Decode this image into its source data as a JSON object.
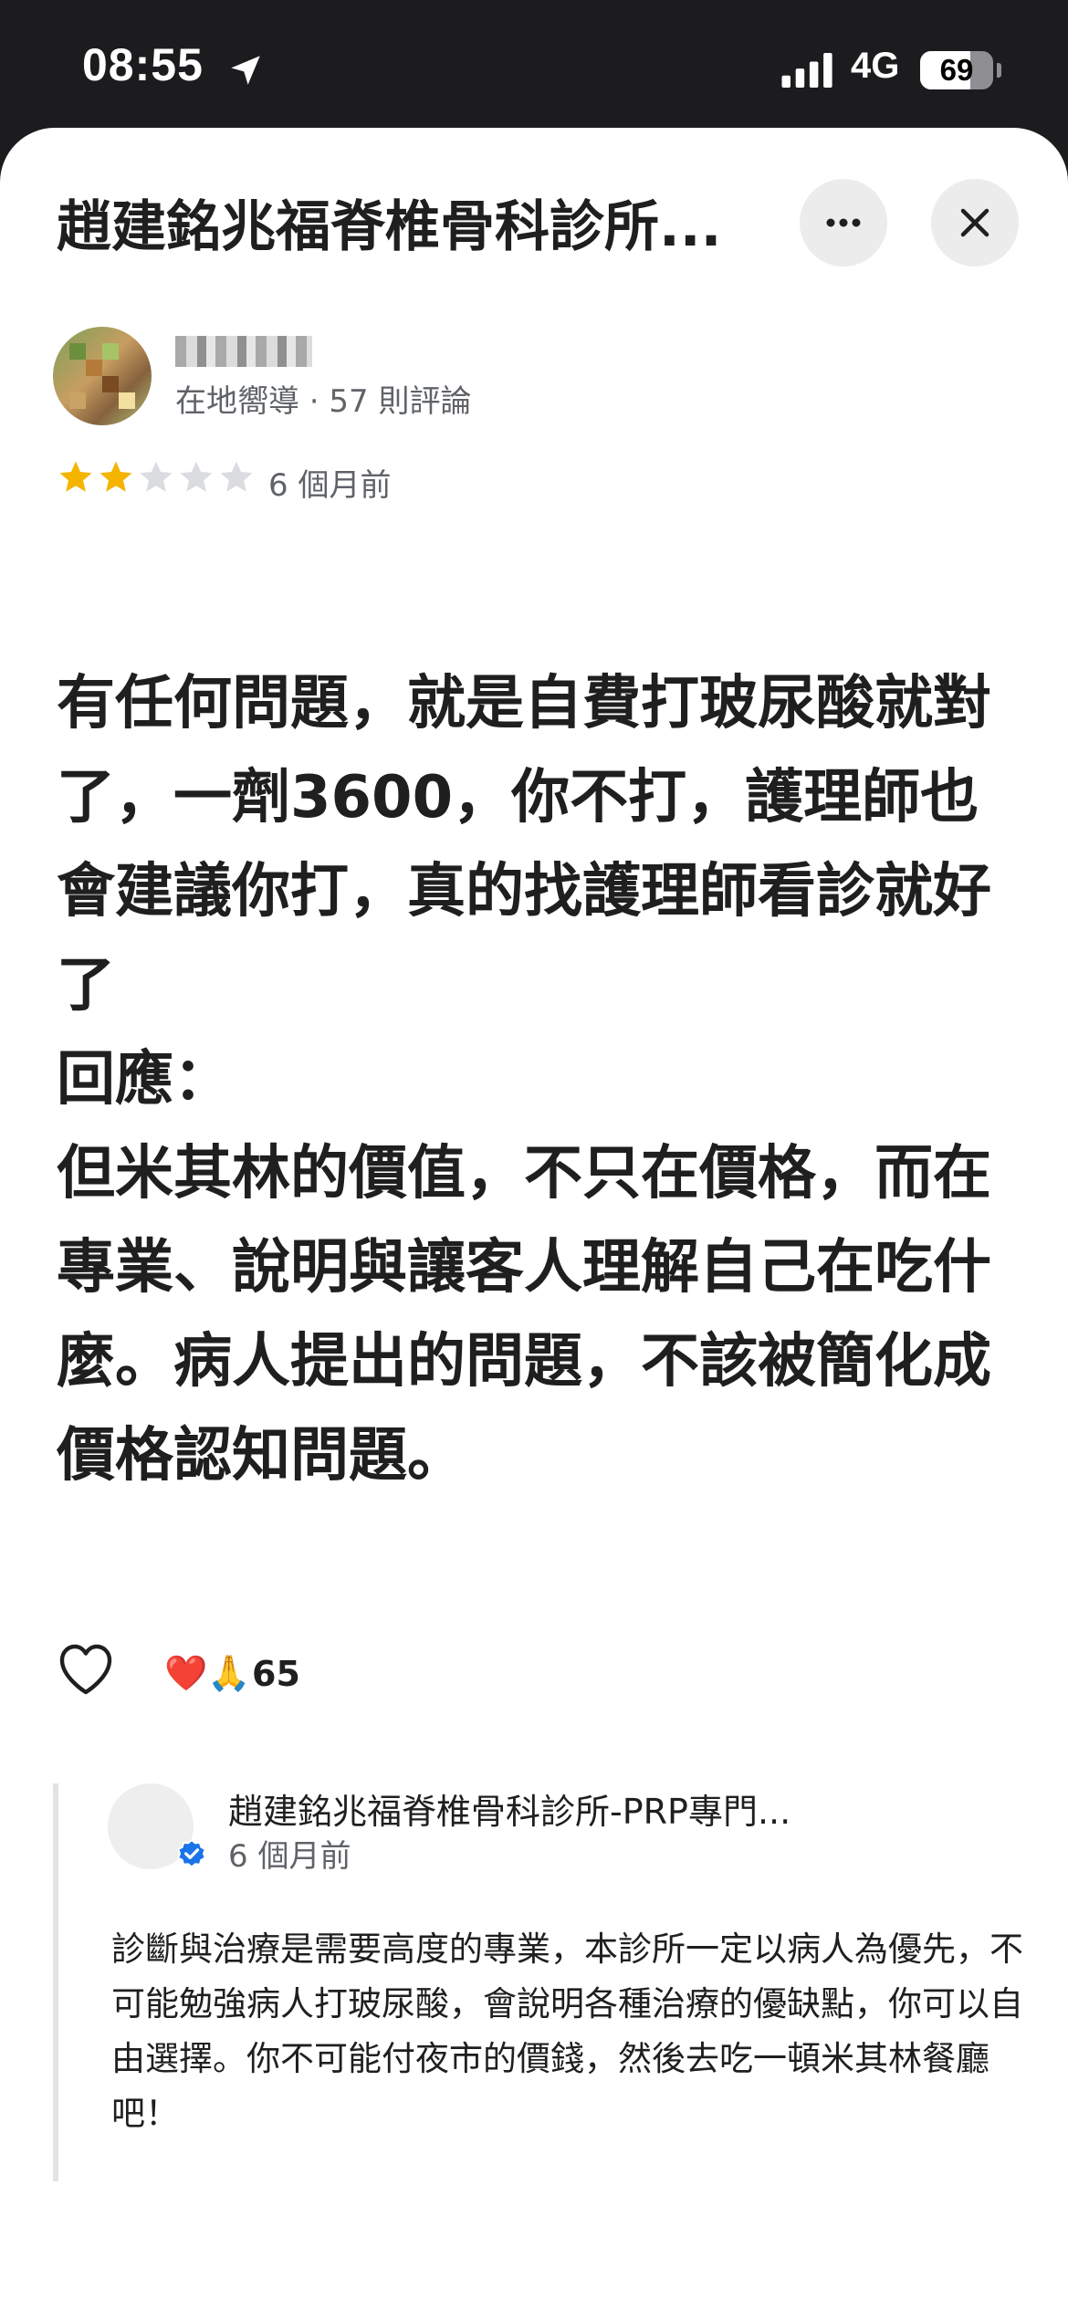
{
  "status_bar": {
    "time": "08:55",
    "network": "4G",
    "battery_percent": "69",
    "battery_level": 0.69,
    "location_icon": "location-arrow-icon",
    "signal_icon": "cellular-signal-icon"
  },
  "header": {
    "title": "趙建銘兆福脊椎骨科診所...",
    "more_icon": "more-horizontal-icon",
    "close_icon": "close-icon"
  },
  "review": {
    "reviewer_meta": "在地嚮導 · 57 則評論",
    "rating": 2,
    "max_rating": 5,
    "time": "6 個月前",
    "body": [
      "有任何問題，就是自費打玻尿酸就對了，一劑3600，你不打，護理師也會建議你打，真的找護理師看診就好了",
      "",
      "回應：",
      "但米其林的價值，不只在價格，而在專業、說明與讓客人理解自己在吃什麼。病人提出的問題，不該被簡化成價格認知問題。"
    ],
    "reactions": "❤️🙏",
    "reaction_count": "65",
    "like_icon": "heart-outline-icon"
  },
  "owner_reply": {
    "name": "趙建銘兆福脊椎骨科診所-PRP專門...",
    "time": "6 個月前",
    "verified_icon": "verified-badge-icon",
    "body": "診斷與治療是需要高度的專業，本診所一定以病人為優先，不可能勉強病人打玻尿酸，會說明各種治療的優缺點，你可以自由選擇。你不可能付夜市的價錢，然後去吃一頓米其林餐廳吧！"
  },
  "colors": {
    "star_filled": "#f4b400",
    "star_empty": "#dadce0",
    "verified": "#1a73e8",
    "text_primary": "#1f1f1f",
    "text_secondary": "#5f6368"
  }
}
